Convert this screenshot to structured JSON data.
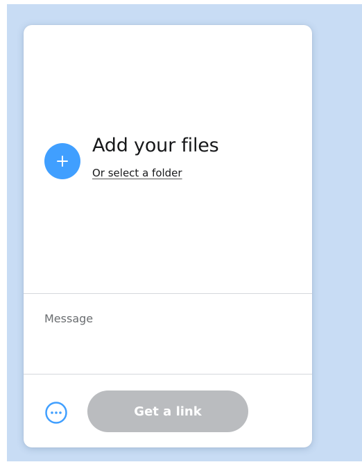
{
  "upload": {
    "title": "Add your files",
    "folder_link": "Or select a folder"
  },
  "message": {
    "placeholder": "Message"
  },
  "footer": {
    "get_link_label": "Get a link"
  },
  "icons": {
    "add": "plus-icon",
    "more": "more-options-icon"
  },
  "colors": {
    "background": "#c8dcf4",
    "accent": "#409fff",
    "button_disabled": "#babcbf"
  }
}
